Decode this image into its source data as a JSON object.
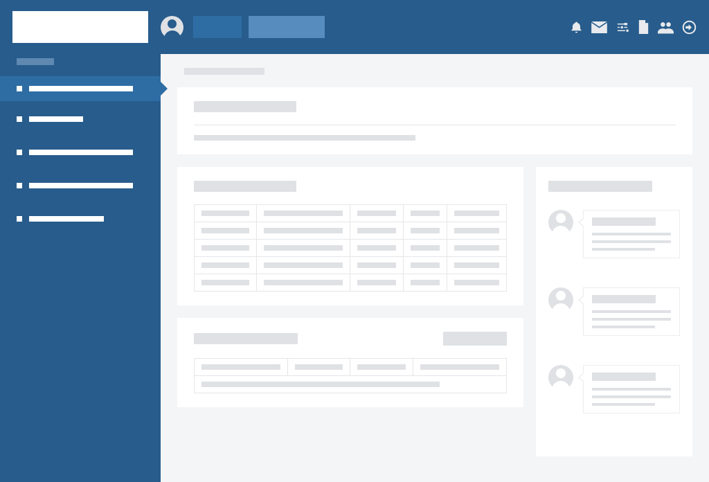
{
  "header": {
    "logo": "",
    "nav_a": "",
    "nav_b": ""
  },
  "sidebar": {
    "section1": "",
    "items": [
      {
        "label": ""
      },
      {
        "label": ""
      },
      {
        "label": ""
      },
      {
        "label": ""
      },
      {
        "label": ""
      }
    ]
  },
  "breadcrumb": "",
  "card1": {
    "title": "",
    "subtitle": ""
  },
  "table": {
    "title": "",
    "rows": [
      [
        "",
        "",
        "",
        "",
        ""
      ],
      [
        "",
        "",
        "",
        "",
        ""
      ],
      [
        "",
        "",
        "",
        "",
        ""
      ],
      [
        "",
        "",
        "",
        "",
        ""
      ],
      [
        "",
        "",
        "",
        "",
        ""
      ]
    ]
  },
  "form": {
    "title": "",
    "button": "",
    "row": [
      "",
      "",
      "",
      ""
    ],
    "long": ""
  },
  "activity": {
    "title": "",
    "items": [
      {
        "name": "",
        "text": ""
      },
      {
        "name": "",
        "text": ""
      },
      {
        "name": "",
        "text": ""
      }
    ]
  }
}
